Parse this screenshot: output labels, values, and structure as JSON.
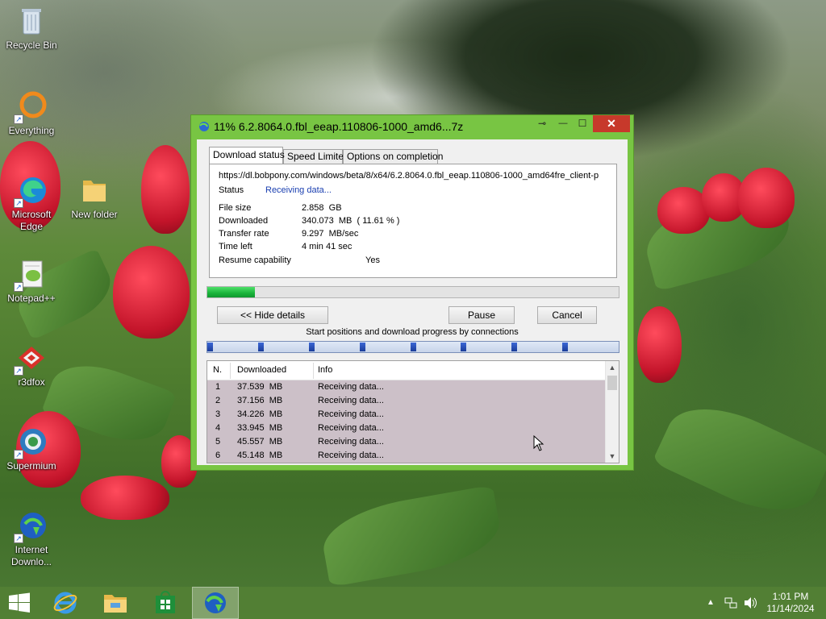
{
  "desktop": {
    "icons": [
      {
        "label": "Recycle Bin"
      },
      {
        "label": "Everything"
      },
      {
        "label": "Microsoft Edge"
      },
      {
        "label": "New folder"
      },
      {
        "label": "Notepad++"
      },
      {
        "label": "r3dfox"
      },
      {
        "label": "Supermium"
      },
      {
        "label": "Internet Downlo..."
      }
    ]
  },
  "window": {
    "title": "11% 6.2.8064.0.fbl_eeap.110806-1000_amd6...7z",
    "close_glyph": "✕",
    "minimize_glyph": "—",
    "maximize_glyph": "☐",
    "tabs": [
      "Download status",
      "Speed Limiter",
      "Options on completion"
    ],
    "url": "https://dl.bobpony.com/windows/beta/8/x64/6.2.8064.0.fbl_eeap.110806-1000_amd64fre_client-p",
    "status_label": "Status",
    "status_value": "Receiving data...",
    "file_size_label": "File size",
    "file_size_value": "2.858  GB",
    "downloaded_label": "Downloaded",
    "downloaded_value": "340.073  MB  ( 11.61 % )",
    "transfer_rate_label": "Transfer rate",
    "transfer_rate_value": "9.297  MB/sec",
    "time_left_label": "Time left",
    "time_left_value": "4 min 41 sec",
    "resume_label": "Resume capability",
    "resume_value": "Yes",
    "progress_fraction": 0.1161,
    "hide_details_label": "<< Hide details",
    "pause_label": "Pause",
    "cancel_label": "Cancel",
    "connections_caption": "Start positions and download progress by connections",
    "connection_starts": [
      0.0,
      0.125,
      0.25,
      0.375,
      0.5,
      0.625,
      0.75,
      0.875
    ],
    "columns": [
      "N.",
      "Downloaded",
      "Info"
    ],
    "connections": [
      {
        "n": "1",
        "downloaded": "37.539  MB",
        "info": "Receiving data..."
      },
      {
        "n": "2",
        "downloaded": "37.156  MB",
        "info": "Receiving data..."
      },
      {
        "n": "3",
        "downloaded": "34.226  MB",
        "info": "Receiving data..."
      },
      {
        "n": "4",
        "downloaded": "33.945  MB",
        "info": "Receiving data..."
      },
      {
        "n": "5",
        "downloaded": "45.557  MB",
        "info": "Receiving data..."
      },
      {
        "n": "6",
        "downloaded": "45.148  MB",
        "info": "Receiving data..."
      }
    ]
  },
  "taskbar": {
    "clock_time": "1:01 PM",
    "clock_date": "11/14/2024"
  }
}
